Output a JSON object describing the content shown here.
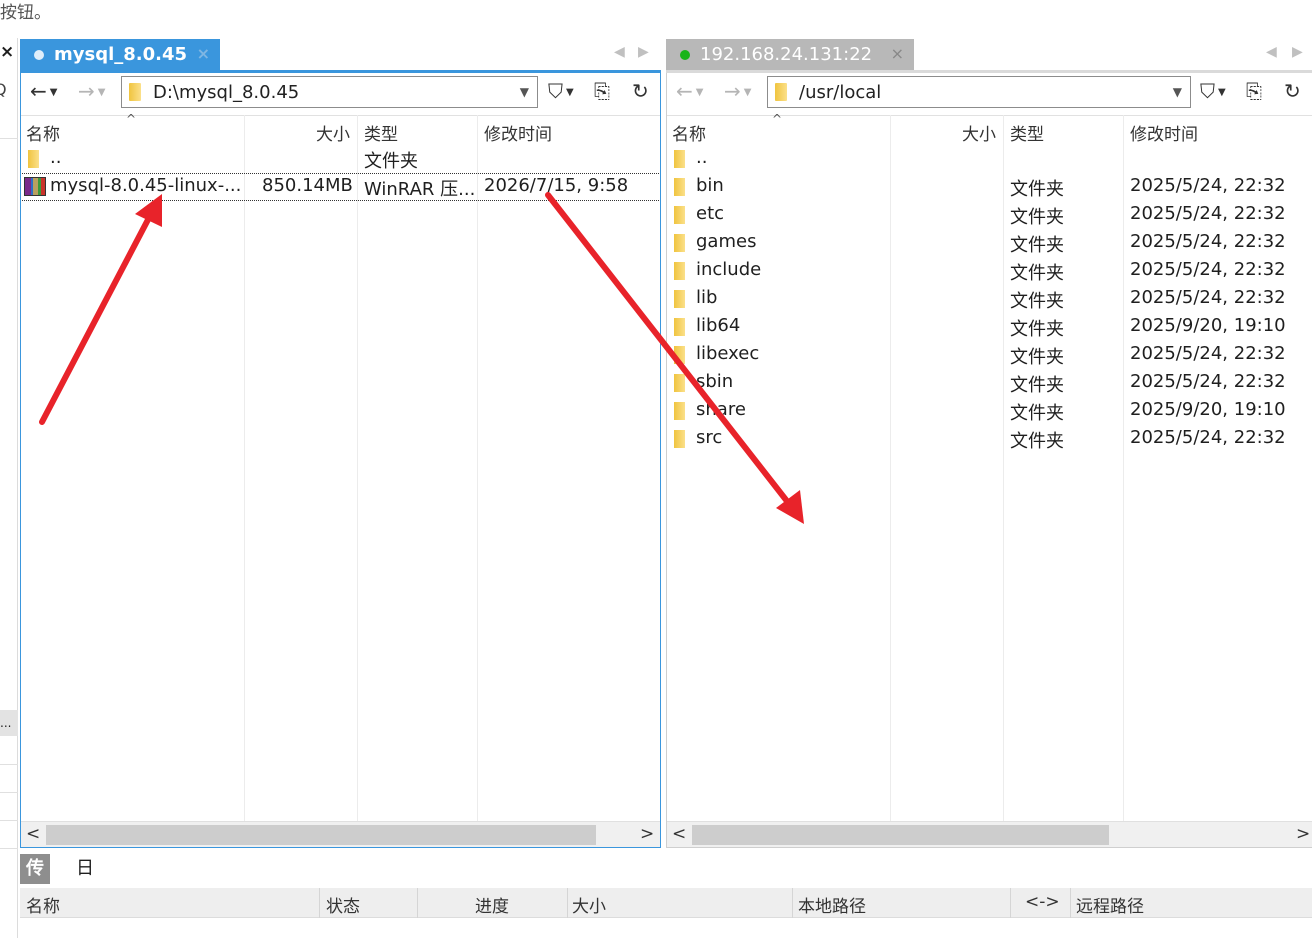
{
  "caption": "按钮。",
  "left_strip": {
    "close": "×",
    "search": "Q",
    "more": "..."
  },
  "left_panel": {
    "tab_title": "mysql_8.0.45",
    "path": "D:\\mysql_8.0.45",
    "columns": {
      "name": "名称",
      "size": "大小",
      "type": "类型",
      "modified": "修改时间"
    },
    "rows": [
      {
        "name": "..",
        "size": "",
        "type": "文件夹",
        "modified": "",
        "icon": "folder-icon"
      },
      {
        "name": "mysql-8.0.45-linux-...",
        "size": "850.14MB",
        "type": "WinRAR 压...",
        "modified": "2026/7/15, 9:58",
        "icon": "winrar-archive-icon"
      }
    ]
  },
  "right_panel": {
    "tab_title": "192.168.24.131:22",
    "path": "/usr/local",
    "columns": {
      "name": "名称",
      "size": "大小",
      "type": "类型",
      "modified": "修改时间"
    },
    "rows": [
      {
        "name": "..",
        "size": "",
        "type": "",
        "modified": ""
      },
      {
        "name": "bin",
        "size": "",
        "type": "文件夹",
        "modified": "2025/5/24, 22:32"
      },
      {
        "name": "etc",
        "size": "",
        "type": "文件夹",
        "modified": "2025/5/24, 22:32"
      },
      {
        "name": "games",
        "size": "",
        "type": "文件夹",
        "modified": "2025/5/24, 22:32"
      },
      {
        "name": "include",
        "size": "",
        "type": "文件夹",
        "modified": "2025/5/24, 22:32"
      },
      {
        "name": "lib",
        "size": "",
        "type": "文件夹",
        "modified": "2025/5/24, 22:32"
      },
      {
        "name": "lib64",
        "size": "",
        "type": "文件夹",
        "modified": "2025/9/20, 19:10"
      },
      {
        "name": "libexec",
        "size": "",
        "type": "文件夹",
        "modified": "2025/5/24, 22:32"
      },
      {
        "name": "sbin",
        "size": "",
        "type": "文件夹",
        "modified": "2025/5/24, 22:32"
      },
      {
        "name": "share",
        "size": "",
        "type": "文件夹",
        "modified": "2025/9/20, 19:10"
      },
      {
        "name": "src",
        "size": "",
        "type": "文件夹",
        "modified": "2025/5/24, 22:32"
      }
    ]
  },
  "bottom": {
    "tabs": [
      "传输",
      "日志"
    ],
    "columns": [
      "名称",
      "状态",
      "进度",
      "大小",
      "本地路径",
      "<->",
      "远程路径"
    ]
  },
  "colors": {
    "accent": "#3a96dd",
    "annotation_arrow": "#e8232a",
    "connected": "#19b419"
  }
}
